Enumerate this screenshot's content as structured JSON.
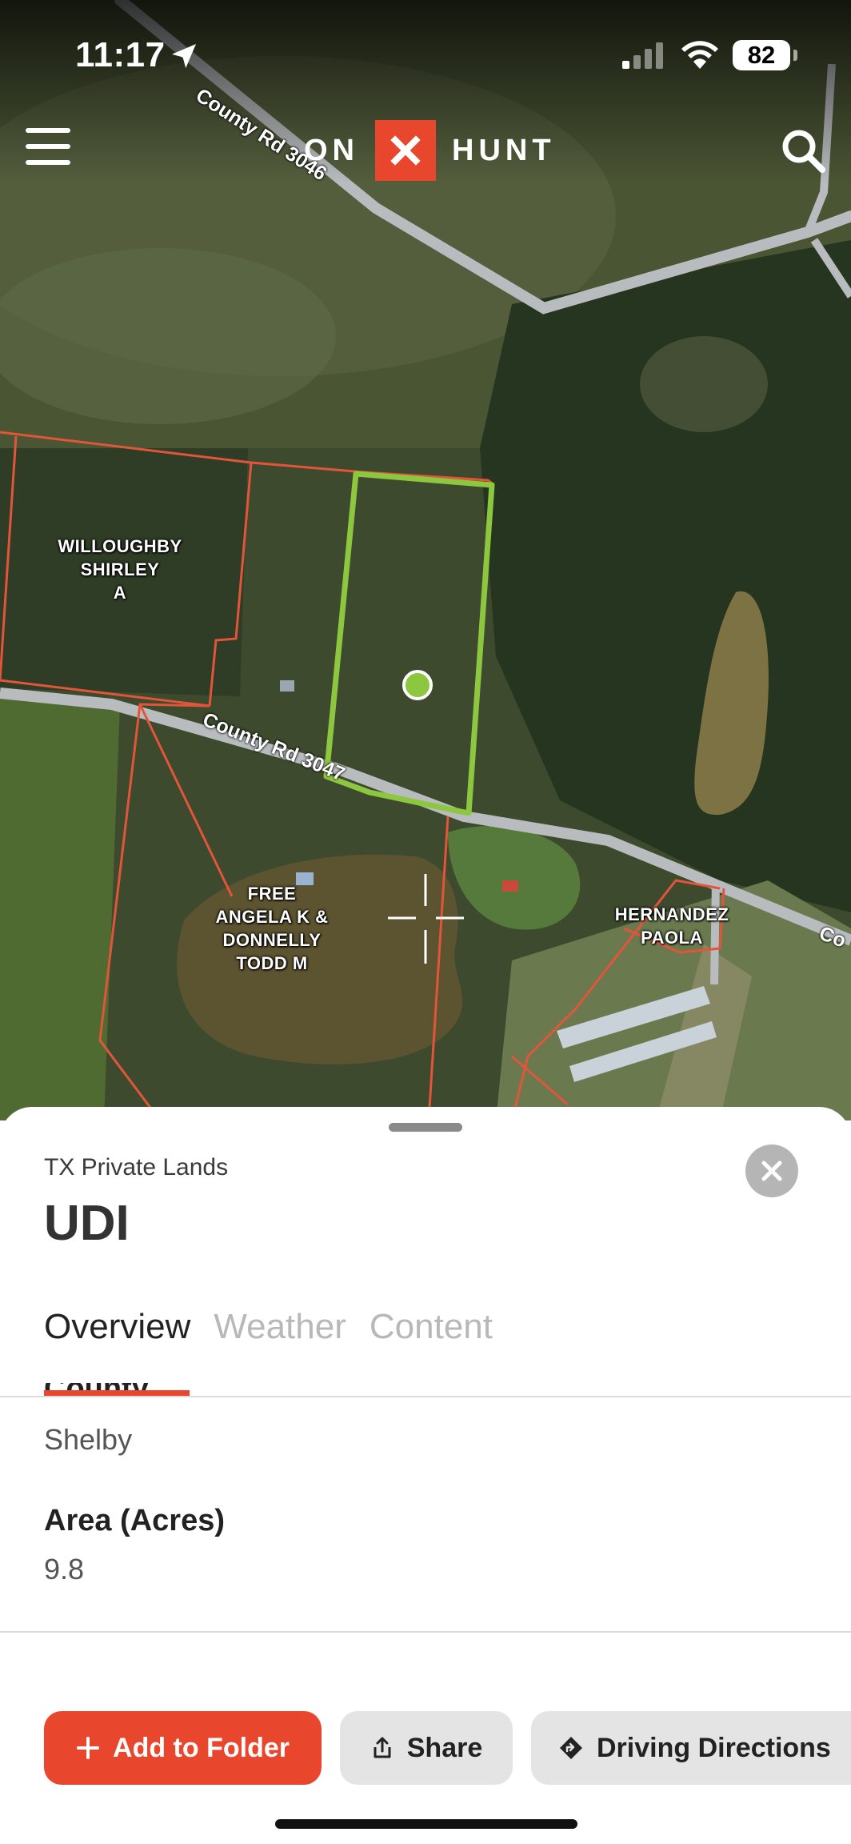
{
  "status_bar": {
    "time": "11:17",
    "battery": "82",
    "icons": [
      "location-arrow-icon",
      "cellular-signal-icon",
      "wifi-icon",
      "battery-icon"
    ]
  },
  "header": {
    "logo_left": "ON",
    "logo_mark": "✕",
    "logo_right": "HUNT",
    "menu_icon": "hamburger-menu-icon",
    "search_icon": "search-icon"
  },
  "map": {
    "roads": [
      "County Rd 3046",
      "County Rd 3047",
      "Co"
    ],
    "parcel_owners": [
      "WILLOUGHBY\nSHIRLEY\nA",
      "FREE\nANGELA K &\nDONNELLY\nTODD M",
      "HERNANDEZ\nPAOLA"
    ],
    "colors": {
      "parcel_boundary": "#e2553a",
      "selected_parcel": "#8dc63f",
      "road": "#b9bcbe"
    }
  },
  "sheet": {
    "subtitle": "TX Private Lands",
    "title": "UDI",
    "close_icon": "close-icon",
    "tabs": [
      {
        "label": "Overview",
        "active": true
      },
      {
        "label": "Weather",
        "active": false
      },
      {
        "label": "Content",
        "active": false
      }
    ],
    "fields": [
      {
        "label": "County",
        "value": "Shelby"
      },
      {
        "label": "Area (Acres)",
        "value": "9.8"
      }
    ],
    "buttons": {
      "add_to_folder": "Add to Folder",
      "share": "Share",
      "driving_directions": "Driving Directions"
    }
  },
  "colors": {
    "accent": "#e8472d",
    "secondary_button": "#e4e4e4"
  }
}
